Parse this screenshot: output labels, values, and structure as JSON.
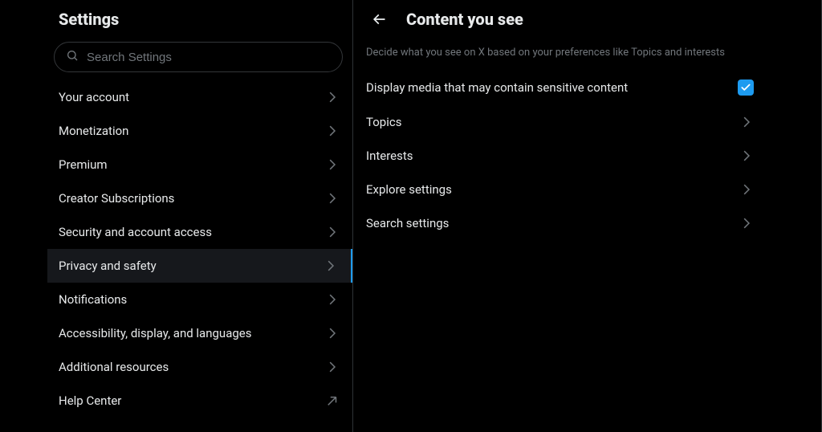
{
  "sidebar": {
    "title": "Settings",
    "search_placeholder": "Search Settings",
    "items": [
      {
        "label": "Your account",
        "link_type": "internal",
        "selected": false
      },
      {
        "label": "Monetization",
        "link_type": "internal",
        "selected": false
      },
      {
        "label": "Premium",
        "link_type": "internal",
        "selected": false
      },
      {
        "label": "Creator Subscriptions",
        "link_type": "internal",
        "selected": false
      },
      {
        "label": "Security and account access",
        "link_type": "internal",
        "selected": false
      },
      {
        "label": "Privacy and safety",
        "link_type": "internal",
        "selected": true
      },
      {
        "label": "Notifications",
        "link_type": "internal",
        "selected": false
      },
      {
        "label": "Accessibility, display, and languages",
        "link_type": "internal",
        "selected": false
      },
      {
        "label": "Additional resources",
        "link_type": "internal",
        "selected": false
      },
      {
        "label": "Help Center",
        "link_type": "external",
        "selected": false
      }
    ]
  },
  "content": {
    "title": "Content you see",
    "description": "Decide what you see on X based on your preferences like Topics and interests",
    "rows": [
      {
        "label": "Display media that may contain sensitive content",
        "control": "checkbox",
        "checked": true
      },
      {
        "label": "Topics",
        "control": "nav"
      },
      {
        "label": "Interests",
        "control": "nav"
      },
      {
        "label": "Explore settings",
        "control": "nav"
      },
      {
        "label": "Search settings",
        "control": "nav"
      }
    ]
  }
}
